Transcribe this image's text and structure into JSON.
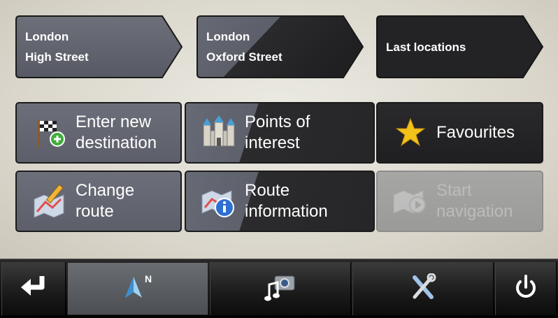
{
  "recent": [
    {
      "city": "London",
      "street": "High Street"
    },
    {
      "city": "London",
      "street": "Oxford Street"
    }
  ],
  "last_locations_label": "Last locations",
  "menu": [
    {
      "label": "Enter new\ndestination",
      "icon": "checkered-flag-add-icon",
      "enabled": true
    },
    {
      "label": "Points of\ninterest",
      "icon": "castle-icon",
      "enabled": true
    },
    {
      "label": "Favourites",
      "icon": "star-icon",
      "enabled": true
    },
    {
      "label": "Change\nroute",
      "icon": "map-pencil-icon",
      "enabled": true
    },
    {
      "label": "Route\ninformation",
      "icon": "map-info-icon",
      "enabled": true
    },
    {
      "label": "Start\nnavigation",
      "icon": "map-play-icon",
      "enabled": false
    }
  ],
  "toolbar": {
    "north_label": "N",
    "icons": [
      "back-arrow-icon",
      "compass-north-icon",
      "media-camera-icon",
      "tools-icon",
      "power-icon"
    ],
    "active": "compass-north-icon"
  },
  "colors": {
    "accent_star": "#f2c21b",
    "tile_dark": "#262628",
    "tile_light": "#5e616c",
    "disabled": "#9a9b99"
  }
}
